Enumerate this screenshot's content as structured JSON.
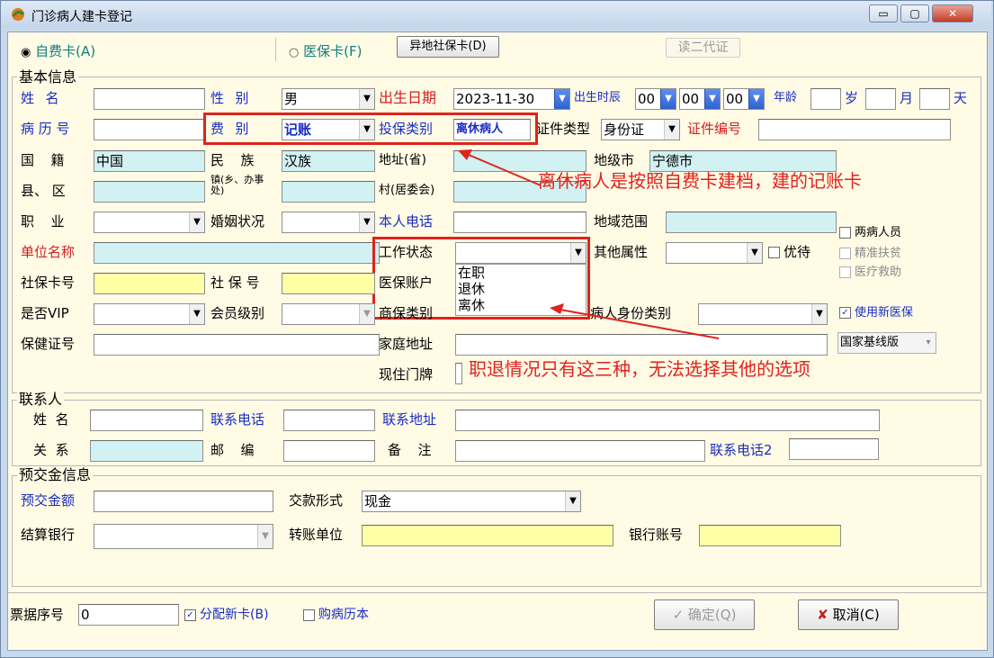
{
  "window": {
    "title": "门诊病人建卡登记",
    "minimize": "▭",
    "maximize": "▢",
    "close": "✕"
  },
  "card_type": {
    "self_pay": "自费卡(A)",
    "medical_insurance": "医保卡(F)",
    "other_region_button": "异地社保卡(D)",
    "read_id_button": "读二代证"
  },
  "basic": {
    "group_title": "基本信息",
    "name_label": "姓  名",
    "name_value": "",
    "gender_label": "性  别",
    "gender_value": "男",
    "birth_label": "出生日期",
    "birth_value": "2023-11-30",
    "birth_time_label": "出生时辰",
    "hour": "00",
    "minute": "00",
    "second": "00",
    "age_label": "年龄",
    "years_unit": "岁",
    "months_unit": "月",
    "days_unit": "天",
    "record_no_label": "病 历 号",
    "fee_type_label": "费  别",
    "fee_type_value": "记账",
    "insured_type_label": "投保类别",
    "insured_type_value": "离休病人",
    "id_type_label": "证件类型",
    "id_type_value": "身份证",
    "id_no_label": "证件编号",
    "nationality_label": "国  籍",
    "nationality_value": "中国",
    "ethnicity_label": "民  族",
    "ethnicity_value": "汉族",
    "province_label": "地址(省)",
    "city_label": "地级市",
    "city_value": "宁德市",
    "county_label": "县、 区",
    "town_label": "镇(乡、办事处)",
    "village_label": "村(居委会)",
    "job_label": "职  业",
    "marital_label": "婚姻状况",
    "phone_label": "本人电话",
    "region_label": "地域范围",
    "employer_label": "单位名称",
    "work_status_label": "工作状态",
    "work_status_value": "",
    "work_status_options": [
      "在职",
      "退休",
      "离休"
    ],
    "other_attr_label": "其他属性",
    "priority_label": "优待",
    "social_card_label": "社保卡号",
    "social_no_label": "社 保 号",
    "med_account_label": "医保账户",
    "vip_label": "是否VIP",
    "member_level_label": "会员级别",
    "commercial_label": "商保类别",
    "identity_type_label": "病人身份类别",
    "two_disease_label": "两病人员",
    "poverty_label": "精准扶贫",
    "medical_aid_label": "医疗救助",
    "new_insurance_label": "使用新医保",
    "baseline_select": "国家基线版",
    "health_cert_label": "保健证号",
    "home_addr_label": "家庭地址",
    "door_label": "现住门牌"
  },
  "annotations": {
    "note1": "离休病人是按照自费卡建档，建的记账卡",
    "note2": "职退情况只有这三种，无法选择其他的选项"
  },
  "contact": {
    "group_title": "联系人",
    "name_label": "姓  名",
    "phone_label": "联系电话",
    "address_label": "联系地址",
    "relation_label": "关  系",
    "zip_label": "邮  编",
    "remark_label": "备  注",
    "phone2_label": "联系电话2"
  },
  "deposit": {
    "group_title": "预交金信息",
    "amount_label": "预交金额",
    "payment_label": "交款形式",
    "payment_value": "现金",
    "bank_label": "结算银行",
    "transfer_label": "转账单位",
    "account_label": "银行账号"
  },
  "footer": {
    "receipt_label": "票据序号",
    "receipt_value": "0",
    "assign_card_label": "分配新卡(B)",
    "buy_record_label": "购病历本",
    "confirm_label": "确定(Q)",
    "cancel_label": "取消(C)"
  }
}
